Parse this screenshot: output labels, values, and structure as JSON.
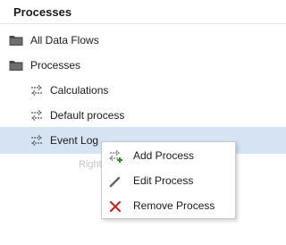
{
  "panel": {
    "title": "Processes"
  },
  "tree": {
    "folders": [
      {
        "label": "All Data Flows",
        "icon": "folder-icon"
      },
      {
        "label": "Processes",
        "icon": "folder-icon"
      }
    ],
    "processes": [
      {
        "label": "Calculations",
        "icon": "process-flow-icon",
        "selected": false
      },
      {
        "label": "Default process",
        "icon": "process-flow-icon",
        "selected": false
      },
      {
        "label": "Event Log",
        "icon": "process-flow-icon",
        "selected": true
      }
    ]
  },
  "hint_text": "Right",
  "context_menu": {
    "items": [
      {
        "label": "Add Process",
        "icon": "add-process-icon",
        "icon_color": "#2e8b2e"
      },
      {
        "label": "Edit Process",
        "icon": "pencil-icon",
        "icon_color": "#666666"
      },
      {
        "label": "Remove Process",
        "icon": "remove-icon",
        "icon_color": "#c62828"
      }
    ]
  },
  "colors": {
    "selection": "#d5e3f3",
    "folder_icon": "#4a4a4a"
  }
}
